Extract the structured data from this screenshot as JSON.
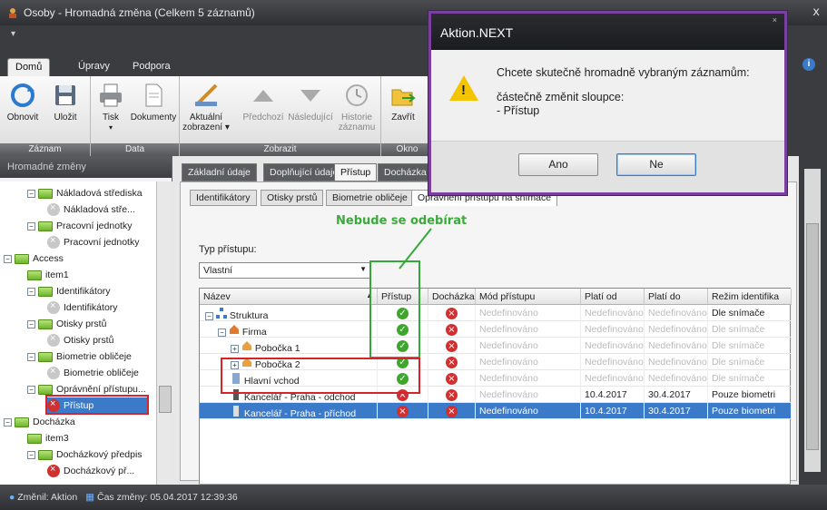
{
  "window": {
    "title": "Osoby - Hromadná změna (Celkem 5 záznamů)",
    "close": "x"
  },
  "ribbon": {
    "tabs": [
      "Domů",
      "Úpravy",
      "Podpora"
    ],
    "groups": {
      "zaznam": "Záznam",
      "data": "Data",
      "zobrazit": "Zobrazit",
      "okno": "Okno"
    },
    "buttons": {
      "refresh": "Obnovit",
      "save": "Uložit",
      "print": "Tisk",
      "documents": "Dokumenty",
      "current_view_1": "Aktuální",
      "current_view_2": "zobrazení ▾",
      "previous": "Předchozí",
      "next": "Následující",
      "history_1": "Historie",
      "history_2": "záznamu",
      "close": "Zavřít"
    }
  },
  "left_panel": {
    "title": "Hromadné změny",
    "tree": [
      "Nákladová střediska",
      "Nákladová stře...",
      "Pracovní jednotky",
      "Pracovní jednotky",
      "Access",
      "item1",
      "Identifikátory",
      "Identifikátory",
      "Otisky prstů",
      "Otisky prstů",
      "Biometrie obličeje",
      "Biometrie obličeje",
      "Oprávnění přístupu...",
      "Přístup",
      "Docházka",
      "item3",
      "Docházkový předpis",
      "Docházkový př..."
    ]
  },
  "main": {
    "tabs": [
      "Základní údaje",
      "Doplňující údaje",
      "Přístup",
      "Docházka"
    ],
    "subtabs": [
      "Identifikátory",
      "Otisky prstů",
      "Biometrie obličeje",
      "Oprávnění přístupu na snímače"
    ],
    "type_label": "Typ přístupu:",
    "type_value": "Vlastní",
    "annotation": "Nebude se odebírat",
    "grid": {
      "headers": [
        "Název",
        "Přístup",
        "Docházka",
        "Mód přístupu",
        "Platí od",
        "Platí do",
        "Režim identifika"
      ],
      "rows": [
        {
          "name": "Struktura",
          "access": "ok",
          "att": "no",
          "mode": "Nedefinováno",
          "from": "Nedefinováno",
          "to": "Nedefinováno",
          "regime": "Dle snímače"
        },
        {
          "name": "Firma",
          "access": "ok",
          "att": "no",
          "mode": "Nedefinováno",
          "from": "Nedefinováno",
          "to": "Nedefinováno",
          "regime": "Dle snímače"
        },
        {
          "name": "Pobočka 1",
          "access": "ok",
          "att": "no",
          "mode": "Nedefinováno",
          "from": "Nedefinováno",
          "to": "Nedefinováno",
          "regime": "Dle snímače"
        },
        {
          "name": "Pobočka 2",
          "access": "ok",
          "att": "no",
          "mode": "Nedefinováno",
          "from": "Nedefinováno",
          "to": "Nedefinováno",
          "regime": "Dle snímače"
        },
        {
          "name": "Hlavní vchod",
          "access": "ok",
          "att": "no",
          "mode": "Nedefinováno",
          "from": "Nedefinováno",
          "to": "Nedefinováno",
          "regime": "Dle snímače"
        },
        {
          "name": "Kancelář - Praha - odchod",
          "access": "no",
          "att": "no",
          "mode": "Nedefinováno",
          "from": "10.4.2017",
          "to": "30.4.2017",
          "regime": "Pouze biometri"
        },
        {
          "name": "Kancelář - Praha - příchod",
          "access": "no",
          "att": "no",
          "mode": "Nedefinováno",
          "from": "10.4.2017",
          "to": "30.4.2017",
          "regime": "Pouze biometri"
        }
      ]
    }
  },
  "status": {
    "changed_by": "Změnil: Aktion",
    "changed_time": "Čas změny: 05.04.2017 12:39:36"
  },
  "dialog": {
    "title": "Aktion.NEXT",
    "line1": "Chcete skutečně hromadně vybraným záznamům:",
    "line2": "částečně změnit sloupce:",
    "line3": "- Přístup",
    "yes": "Ano",
    "no": "Ne"
  },
  "colors": {
    "highlight_red": "#d8232a",
    "highlight_green": "#35a83a",
    "dialog_border": "#7b3fa0",
    "selection": "#3b79c9"
  }
}
